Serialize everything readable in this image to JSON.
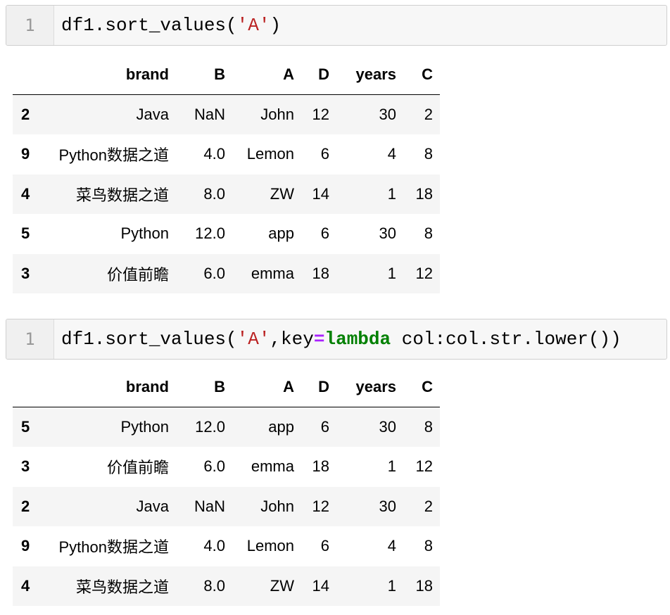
{
  "cells": [
    {
      "line_number": "1",
      "code_tokens": [
        {
          "text": "df1.sort_values(",
          "style": "plain"
        },
        {
          "text": "'A'",
          "style": "string"
        },
        {
          "text": ")",
          "style": "plain"
        }
      ],
      "output": {
        "columns": [
          "",
          "brand",
          "B",
          "A",
          "D",
          "years",
          "C"
        ],
        "rows": [
          {
            "index": "2",
            "brand": "Java",
            "B": "NaN",
            "A": "John",
            "D": "12",
            "years": "30",
            "C": "2"
          },
          {
            "index": "9",
            "brand": "Python数据之道",
            "B": "4.0",
            "A": "Lemon",
            "D": "6",
            "years": "4",
            "C": "8"
          },
          {
            "index": "4",
            "brand": "菜鸟数据之道",
            "B": "8.0",
            "A": "ZW",
            "D": "14",
            "years": "1",
            "C": "18"
          },
          {
            "index": "5",
            "brand": "Python",
            "B": "12.0",
            "A": "app",
            "D": "6",
            "years": "30",
            "C": "8"
          },
          {
            "index": "3",
            "brand": "价值前瞻",
            "B": "6.0",
            "A": "emma",
            "D": "18",
            "years": "1",
            "C": "12"
          }
        ]
      }
    },
    {
      "line_number": "1",
      "code_tokens": [
        {
          "text": "df1.sort_values(",
          "style": "plain"
        },
        {
          "text": "'A'",
          "style": "string"
        },
        {
          "text": ",key",
          "style": "plain"
        },
        {
          "text": "=",
          "style": "operator"
        },
        {
          "text": "lambda",
          "style": "keyword"
        },
        {
          "text": " col:col.str.lower())",
          "style": "plain"
        }
      ],
      "output": {
        "columns": [
          "",
          "brand",
          "B",
          "A",
          "D",
          "years",
          "C"
        ],
        "rows": [
          {
            "index": "5",
            "brand": "Python",
            "B": "12.0",
            "A": "app",
            "D": "6",
            "years": "30",
            "C": "8"
          },
          {
            "index": "3",
            "brand": "价值前瞻",
            "B": "6.0",
            "A": "emma",
            "D": "18",
            "years": "1",
            "C": "12"
          },
          {
            "index": "2",
            "brand": "Java",
            "B": "NaN",
            "A": "John",
            "D": "12",
            "years": "30",
            "C": "2"
          },
          {
            "index": "9",
            "brand": "Python数据之道",
            "B": "4.0",
            "A": "Lemon",
            "D": "6",
            "years": "4",
            "C": "8"
          },
          {
            "index": "4",
            "brand": "菜鸟数据之道",
            "B": "8.0",
            "A": "ZW",
            "D": "14",
            "years": "1",
            "C": "18"
          }
        ]
      }
    }
  ],
  "colors": {
    "string": "#ba2121",
    "operator": "#aa22ff",
    "keyword": "#008000",
    "cell_border": "#cfcfcf",
    "cell_background": "#f7f7f7",
    "row_stripe": "#f5f5f5"
  }
}
